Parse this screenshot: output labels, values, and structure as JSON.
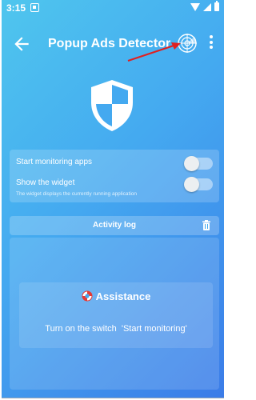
{
  "status": {
    "time": "3:15"
  },
  "appbar": {
    "title": "Popup Ads Detector"
  },
  "settings": {
    "start_monitoring_label": "Start monitoring apps",
    "start_monitoring_on": false,
    "show_widget_label": "Show the widget",
    "show_widget_desc": "The widget displays the currently running application",
    "show_widget_on": false
  },
  "activity": {
    "title": "Activity log"
  },
  "assistance": {
    "title": "Assistance",
    "message": "Turn on the switch  'Start monitoring'"
  },
  "colors": {
    "gradient_start": "#4fc6ee",
    "gradient_end": "#3b7ce8",
    "annotation_arrow": "#e02020",
    "lifebuoy_red": "#e53935"
  },
  "icons": [
    "back-arrow",
    "radar",
    "more-vert",
    "shield",
    "trash",
    "lifebuoy"
  ]
}
